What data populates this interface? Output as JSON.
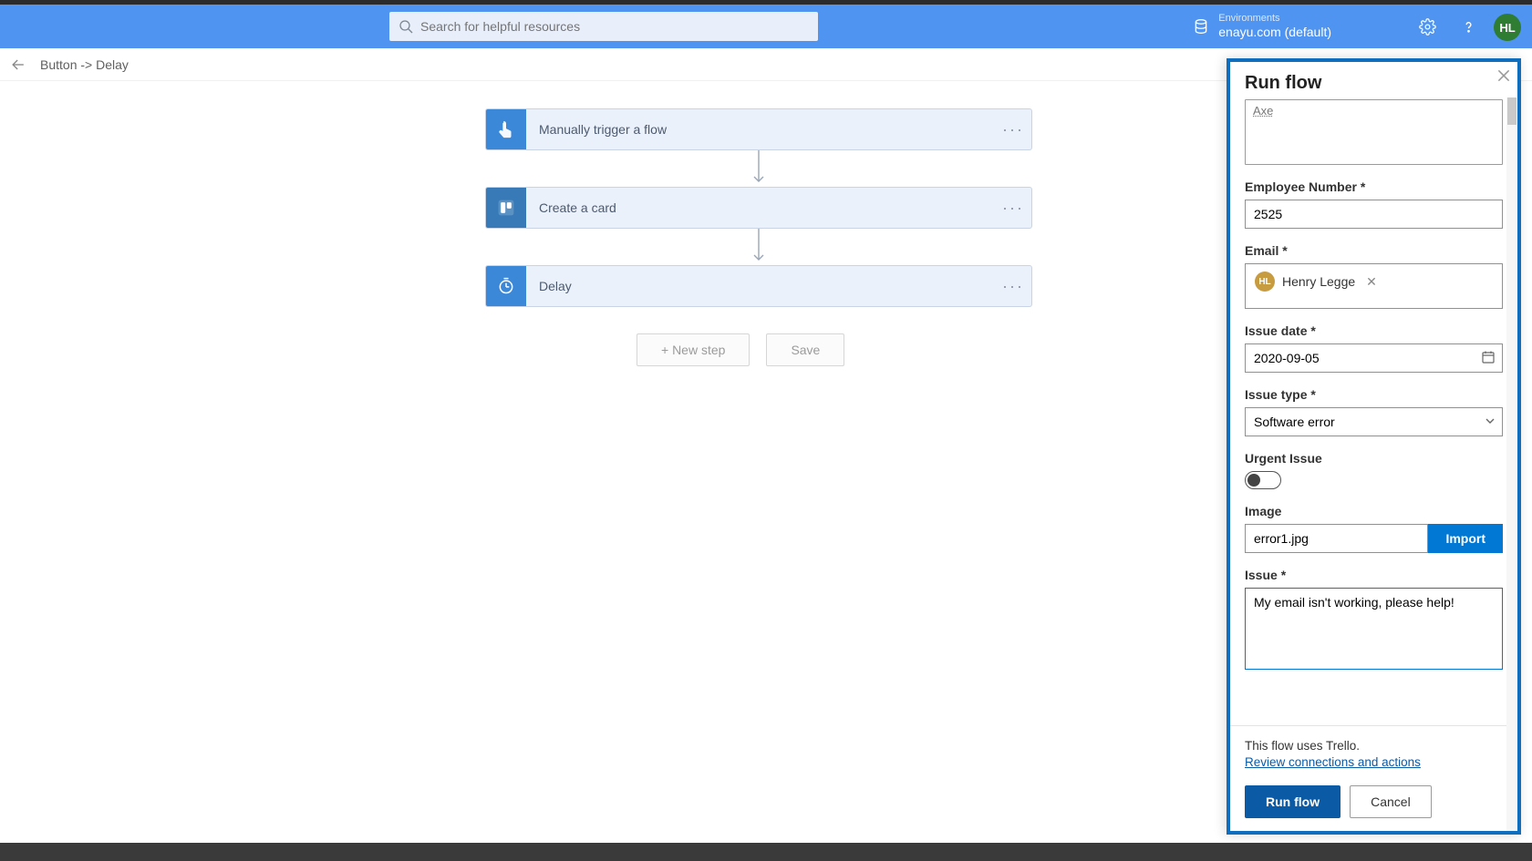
{
  "header": {
    "search_placeholder": "Search for helpful resources",
    "env_label": "Environments",
    "env_value": "enayu.com (default)",
    "avatar": "HL"
  },
  "breadcrumb": "Button -> Delay",
  "steps": [
    {
      "label": "Manually trigger a flow"
    },
    {
      "label": "Create a card"
    },
    {
      "label": "Delay"
    }
  ],
  "actions": {
    "new_step": "+ New step",
    "save": "Save"
  },
  "panel": {
    "title": "Run flow",
    "truncated_value": "Axe",
    "fields": {
      "emp_label": "Employee Number *",
      "emp_value": "2525",
      "email_label": "Email *",
      "email_chip": "Henry Legge",
      "email_chip_initials": "HL",
      "date_label": "Issue date *",
      "date_value": "2020-09-05",
      "type_label": "Issue type *",
      "type_value": "Software error",
      "urgent_label": "Urgent Issue",
      "image_label": "Image",
      "image_value": "error1.jpg",
      "import_btn": "Import",
      "issue_label": "Issue *",
      "issue_value": "My email isn't working, please help!"
    },
    "footer": {
      "conn_text": "This flow uses Trello.",
      "conn_link": "Review connections and actions",
      "run": "Run flow",
      "cancel": "Cancel"
    }
  }
}
